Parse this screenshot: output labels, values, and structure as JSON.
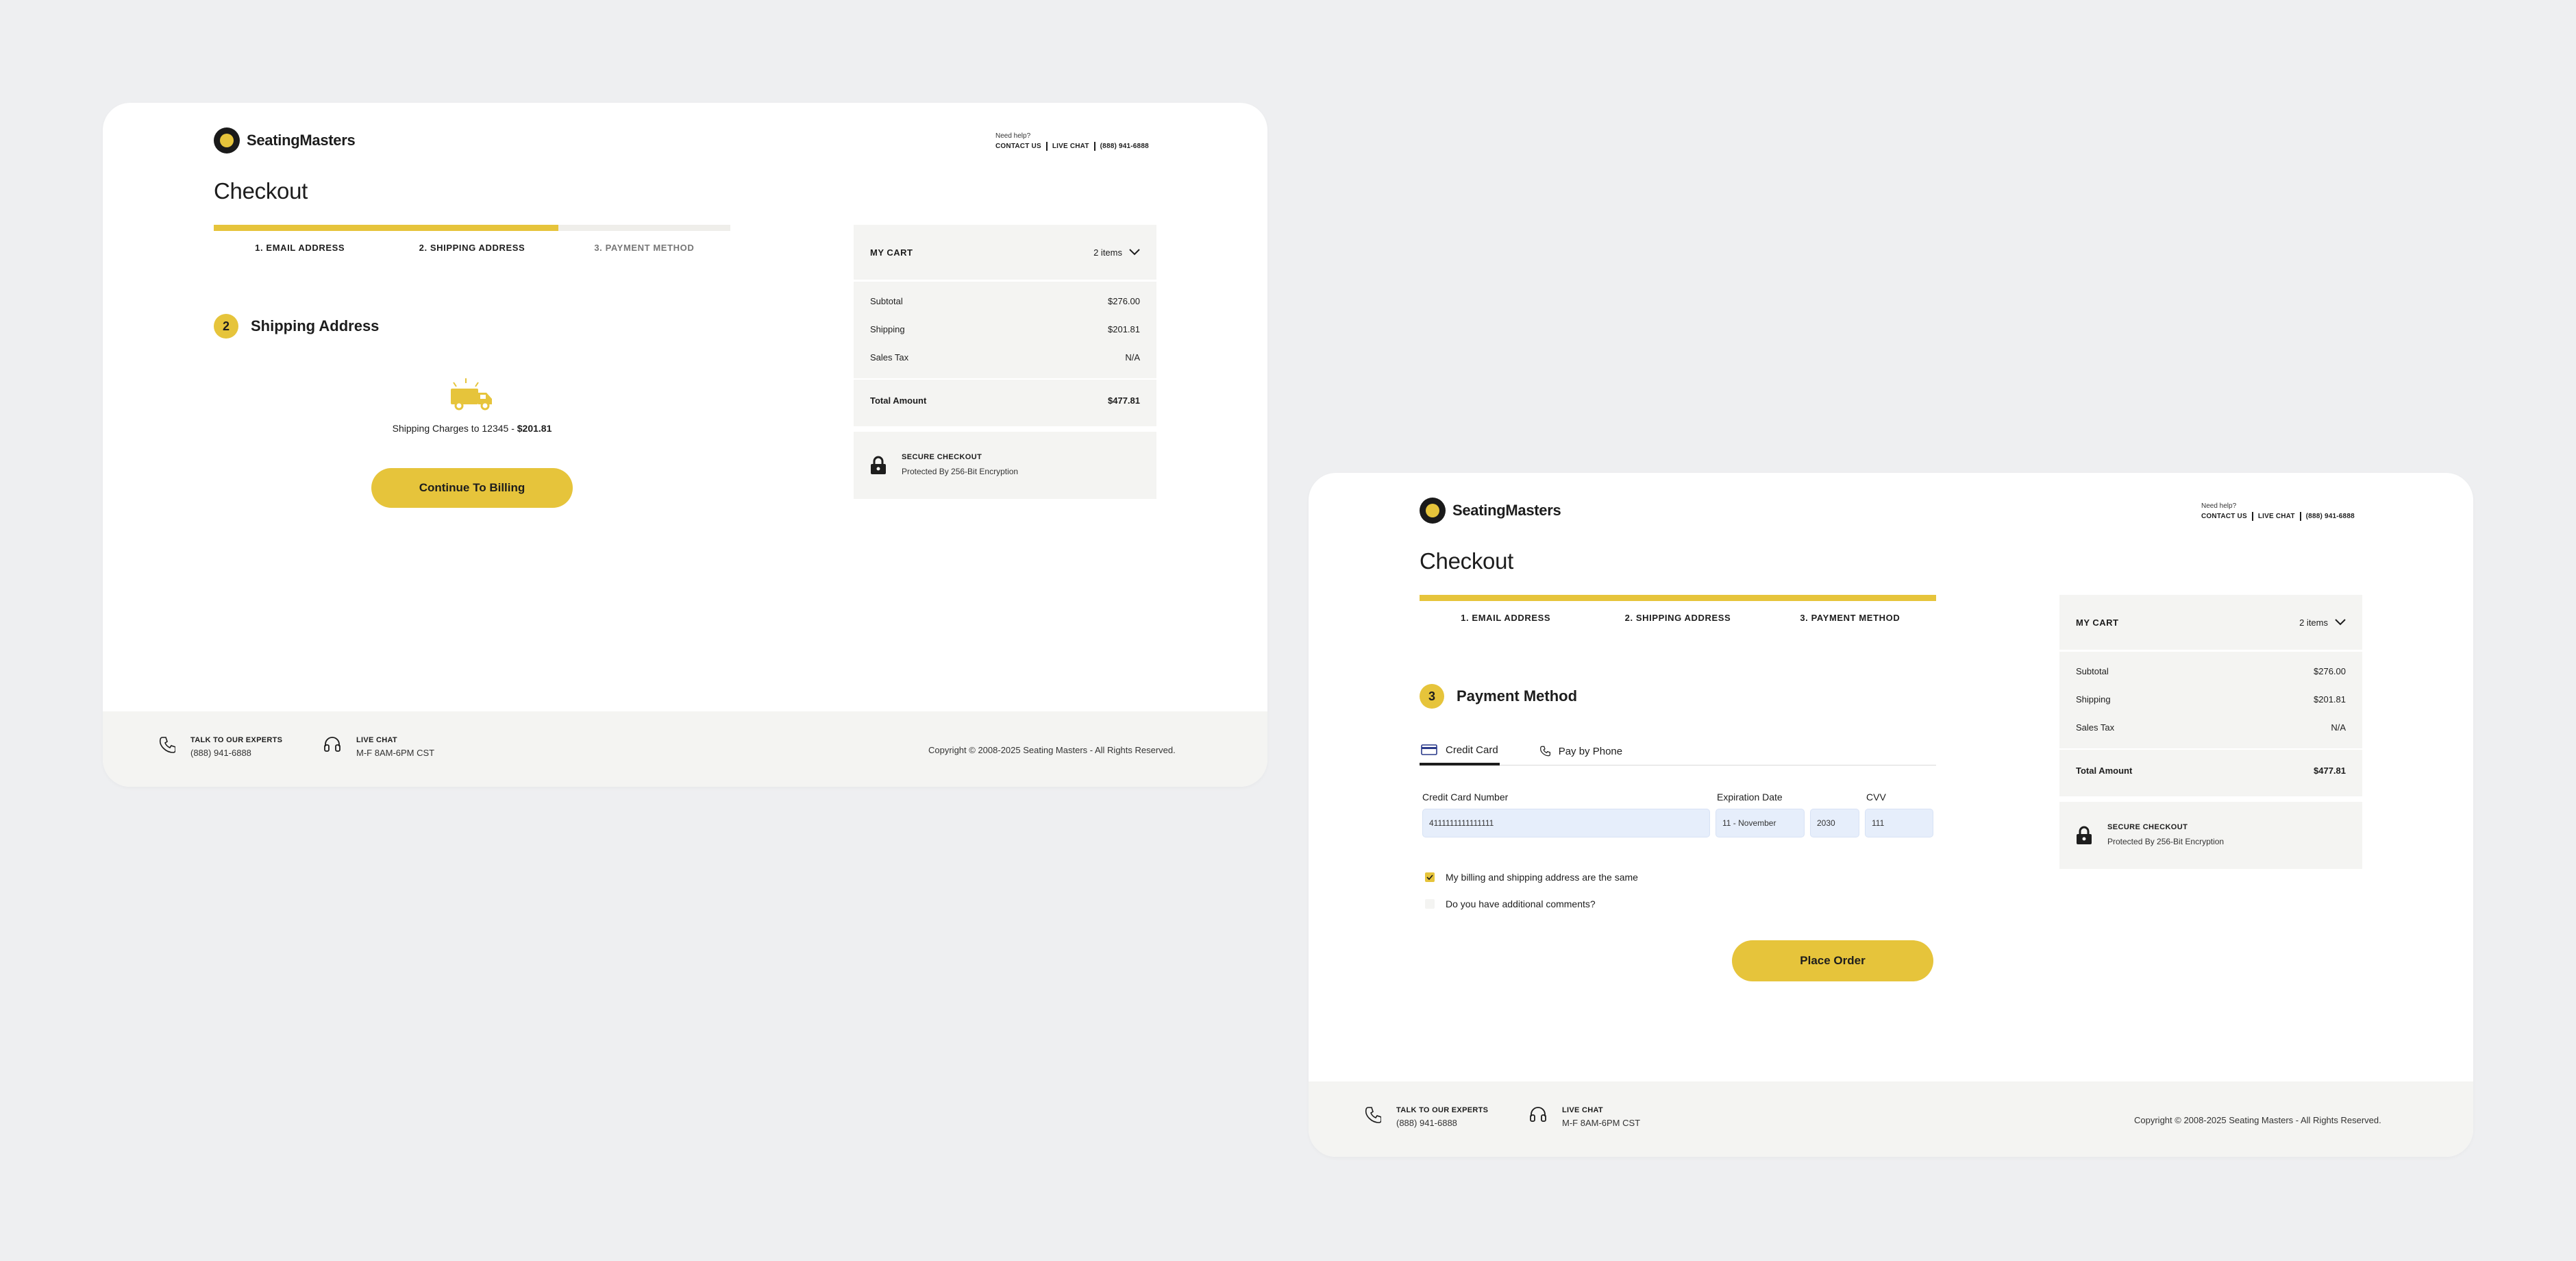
{
  "brand": {
    "name": "SeatingMasters",
    "accent": "#e6c43b"
  },
  "help": {
    "label": "Need help?",
    "contact": "CONTACT US",
    "chat": "LIVE CHAT",
    "phone": "(888) 941-6888"
  },
  "page_title": "Checkout",
  "steps": [
    "1. EMAIL ADDRESS",
    "2. SHIPPING ADDRESS",
    "3. PAYMENT METHOD"
  ],
  "cart": {
    "title": "MY CART",
    "count": "2 items",
    "rows": [
      {
        "label": "Subtotal",
        "value": "$276.00"
      },
      {
        "label": "Shipping",
        "value": "$201.81"
      },
      {
        "label": "Sales Tax",
        "value": "N/A"
      }
    ],
    "total_label": "Total Amount",
    "total_value": "$477.81",
    "secure_title": "SECURE CHECKOUT",
    "secure_sub": "Protected By 256-Bit Encryption"
  },
  "footer": {
    "talk_title": "TALK TO OUR EXPERTS",
    "talk_phone": "(888) 941-6888",
    "chat_title": "LIVE CHAT",
    "chat_hours": "M-F 8AM-6PM CST",
    "copyright": "Copyright © 2008-2025 Seating Masters - All Rights Reserved."
  },
  "shipping_screen": {
    "progress": 0.667,
    "step_number": "2",
    "section_title": "Shipping Address",
    "charges_text": "Shipping Charges to 12345 - ",
    "charges_amount": "$201.81",
    "continue_label": "Continue To Billing"
  },
  "payment_screen": {
    "progress": 1.0,
    "step_number": "3",
    "section_title": "Payment Method",
    "tabs": [
      "Credit Card",
      "Pay by Phone"
    ],
    "card_number_label": "Credit Card Number",
    "card_number_value": "4111111111111111",
    "expiration_label": "Expiration Date",
    "exp_month_value": "11 - November",
    "exp_year_value": "2030",
    "cvv_label": "CVV",
    "cvv_value": "111",
    "same_address_label": "My billing and shipping address are the same",
    "same_address_checked": true,
    "comments_label": "Do you have additional comments?",
    "comments_checked": false,
    "place_order_label": "Place Order"
  }
}
